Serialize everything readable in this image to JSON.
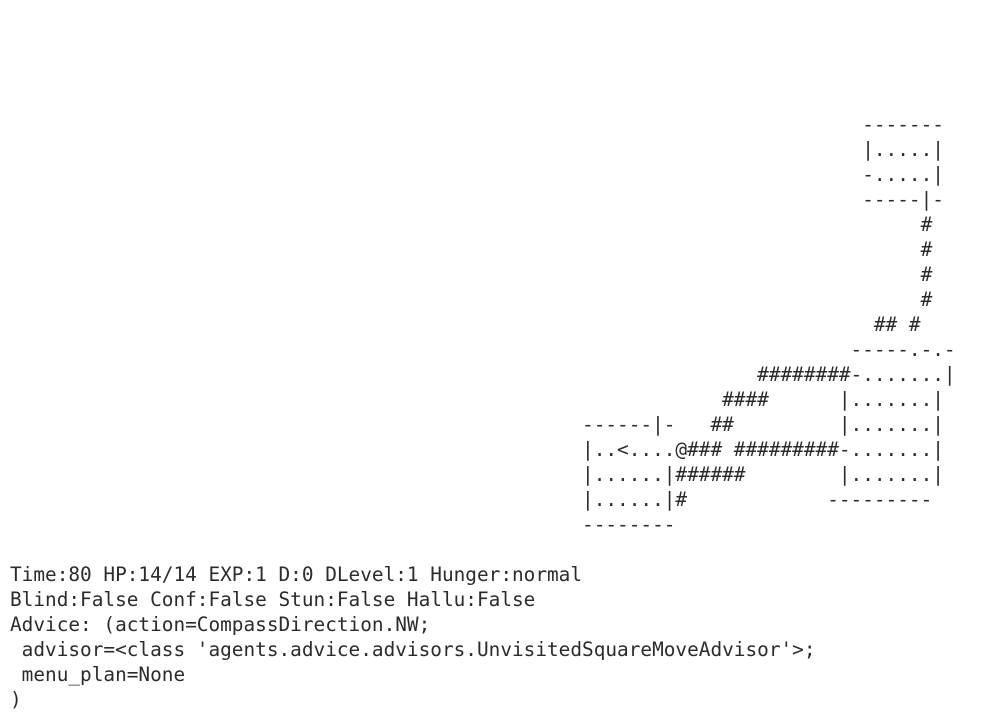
{
  "map_rows": [
    "                                                                         -------",
    "                                                                         |.....|",
    "                                                                         -.....|",
    "                                                                         -----|-",
    "                                                                              #",
    "                                                                              #",
    "                                                                              #",
    "                                                                              #",
    "                                                                          ## #",
    "                                                                        -----.-.-",
    "                                                                ########-.......|",
    "                                                             ####      |.......|",
    "                                                 ------|-   ##         |.......|",
    "                                                 |..<....@### #########-.......|",
    "                                                 |......|######        |.......|",
    "                                                 |......|#            ---------",
    "                                                 --------"
  ],
  "status": {
    "line1": "Time:80 HP:14/14 EXP:1 D:0 DLevel:1 Hunger:normal",
    "line2": "Blind:False Conf:False Stun:False Hallu:False",
    "line3": "Advice: (action=CompassDirection.NW;",
    "line4": " advisor=<class 'agents.advice.advisors.UnvisitedSquareMoveAdvisor'>;",
    "line5": " menu_plan=None",
    "line6": ")"
  }
}
